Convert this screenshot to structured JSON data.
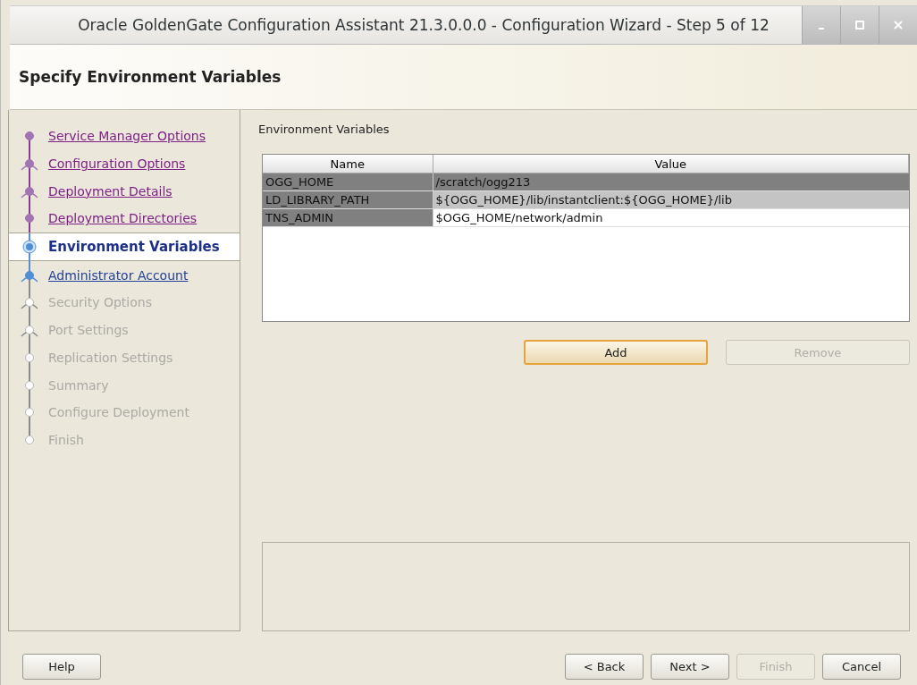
{
  "window": {
    "title": "Oracle GoldenGate Configuration Assistant 21.3.0.0.0 - Configuration Wizard - Step 5 of 12"
  },
  "header": {
    "title": "Specify Environment Variables"
  },
  "steps": [
    {
      "label": "Service Manager Options",
      "kind": "visited",
      "selected": false
    },
    {
      "label": "Configuration Options",
      "kind": "visited",
      "selected": false
    },
    {
      "label": "Deployment Details",
      "kind": "visited",
      "selected": false
    },
    {
      "label": "Deployment Directories",
      "kind": "visited",
      "selected": false
    },
    {
      "label": "Environment Variables",
      "kind": "current",
      "selected": true
    },
    {
      "label": "Administrator Account",
      "kind": "available",
      "selected": false
    },
    {
      "label": "Security Options",
      "kind": "disabled",
      "selected": false
    },
    {
      "label": "Port Settings",
      "kind": "disabled",
      "selected": false
    },
    {
      "label": "Replication Settings",
      "kind": "disabled",
      "selected": false
    },
    {
      "label": "Summary",
      "kind": "disabled",
      "selected": false
    },
    {
      "label": "Configure Deployment",
      "kind": "disabled",
      "selected": false
    },
    {
      "label": "Finish",
      "kind": "disabled",
      "selected": false
    }
  ],
  "section_label": "Environment Variables",
  "table": {
    "columns": [
      "Name",
      "Value"
    ],
    "rows": [
      {
        "name": "OGG_HOME",
        "value": "/scratch/ogg213",
        "selected": true,
        "highlighted": false
      },
      {
        "name": "LD_LIBRARY_PATH",
        "value": "${OGG_HOME}/lib/instantclient:${OGG_HOME}/lib",
        "selected": false,
        "highlighted": true
      },
      {
        "name": "TNS_ADMIN",
        "value": "$OGG_HOME/network/admin",
        "selected": false,
        "highlighted": false
      }
    ]
  },
  "table_buttons": [
    {
      "label": "Add",
      "disabled": false,
      "focused": true
    },
    {
      "label": "Remove",
      "disabled": true,
      "focused": false
    }
  ],
  "footer": {
    "help": {
      "label": "Help",
      "disabled": false
    },
    "buttons": [
      {
        "label": "< Back",
        "disabled": false
      },
      {
        "label": "Next >",
        "disabled": false
      },
      {
        "label": "Finish",
        "disabled": true
      },
      {
        "label": "Cancel",
        "disabled": false
      }
    ]
  }
}
